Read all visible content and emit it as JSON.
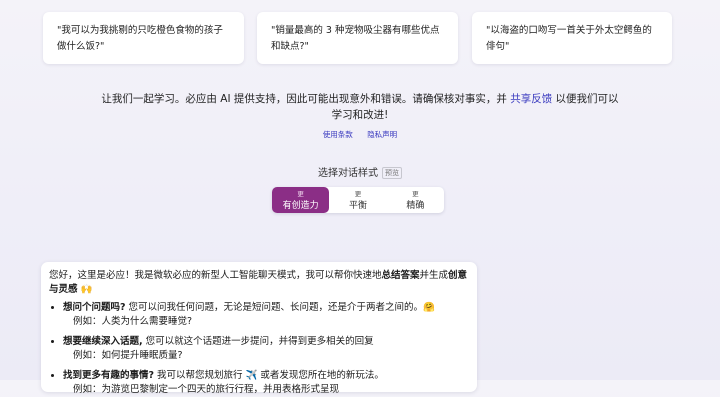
{
  "suggestions": [
    "\"我可以为我挑剔的只吃橙色食物的孩子做什么饭?\"",
    "\"销量最高的 3 种宠物吸尘器有哪些优点和缺点?\"",
    "\"以海盗的口吻写一首关于外太空鳄鱼的俳句\""
  ],
  "disclaimer": {
    "before": "让我们一起学习。必应由 AI 提供支持，因此可能出现意外和错误。请确保核对事实，并 ",
    "link": "共享反馈",
    "after": " 以便我们可以学习和改进!"
  },
  "links": {
    "terms": "使用条款",
    "privacy": "隐私声明"
  },
  "conversation_style": {
    "title": "选择对话样式",
    "badge": "预览",
    "options": [
      {
        "more": "更",
        "label": "有创造力",
        "active": true
      },
      {
        "more": "更",
        "label": "平衡",
        "active": false
      },
      {
        "more": "更",
        "label": "精确",
        "active": false
      }
    ]
  },
  "chat": {
    "intro_a": "您好，这里是必应！我是微软必应的新型人工智能聊天模式，我可以帮你快速地",
    "intro_b1": "总结答案",
    "intro_c": "并生成",
    "intro_b2": "创意与灵感",
    "intro_emoji": "🙌",
    "items": [
      {
        "title": "想问个问题吗?",
        "text": " 您可以问我任何问题，无论是短问题、长问题，还是介于两者之间的。🤗",
        "example": "例如：人类为什么需要睡觉?"
      },
      {
        "title": "想要继续深入话题,",
        "text": " 您可以就这个话题进一步提问，并得到更多相关的回复",
        "example": "例如：如何提升睡眠质量?"
      },
      {
        "title": "找到更多有趣的事情?",
        "text": " 我可以帮您规划旅行 ✈️ 或者发现您所在地的新玩法。",
        "example": "例如：为游览巴黎制定一个四天的旅行行程，并用表格形式呈现"
      }
    ]
  }
}
